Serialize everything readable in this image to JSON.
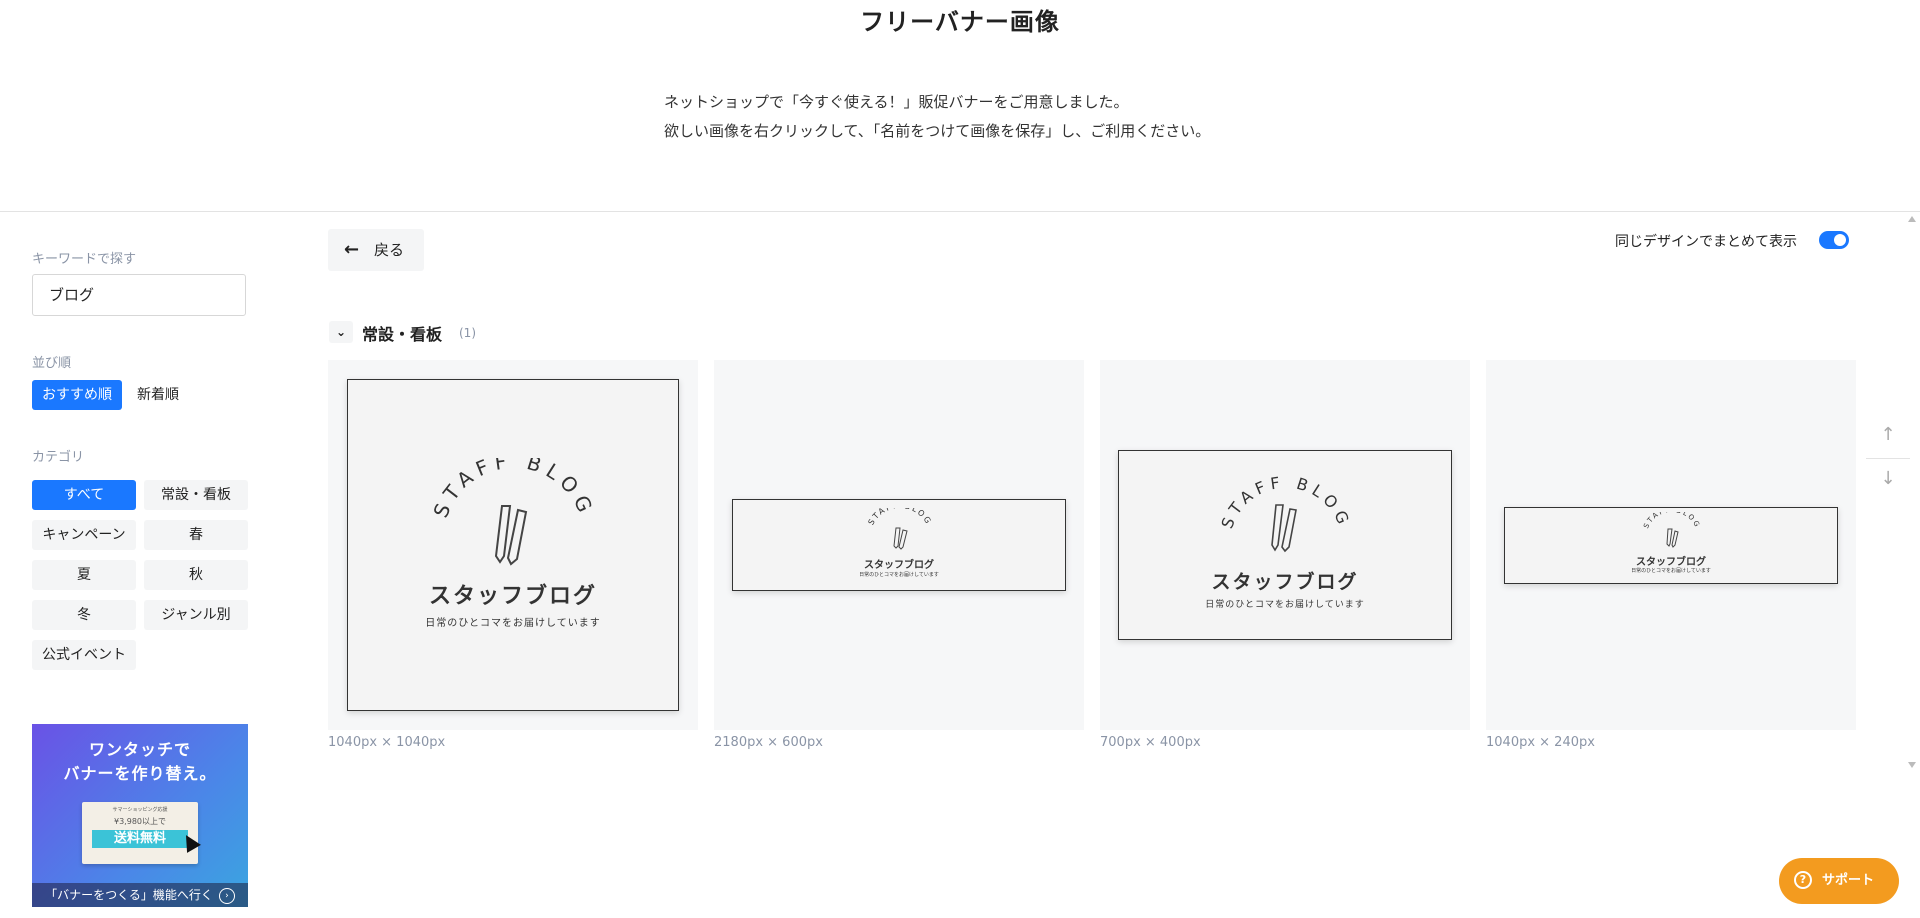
{
  "page": {
    "title": "フリーバナー画像",
    "intro_lines": [
      "ネットショップで「今すぐ使える！」販促バナーをご用意しました。",
      "欲しい画像を右クリックして、「名前をつけて画像を保存」し、ご利用ください。"
    ]
  },
  "sidebar": {
    "keyword_label": "キーワードで探す",
    "keyword_value": "ブログ",
    "sort_label": "並び順",
    "sort_options": [
      {
        "label": "おすすめ順",
        "active": true
      },
      {
        "label": "新着順",
        "active": false
      }
    ],
    "category_label": "カテゴリ",
    "categories": [
      {
        "label": "すべて",
        "active": true
      },
      {
        "label": "常設・看板",
        "active": false
      },
      {
        "label": "キャンペーン",
        "active": false
      },
      {
        "label": "春",
        "active": false
      },
      {
        "label": "夏",
        "active": false
      },
      {
        "label": "秋",
        "active": false
      },
      {
        "label": "冬",
        "active": false
      },
      {
        "label": "ジャンル別",
        "active": false
      },
      {
        "label": "公式イベント",
        "active": false
      }
    ],
    "promo": {
      "title": "ワンタッチで\nバナーを作り替え。",
      "card_sub": "サマーショッピング応援",
      "card_price": "¥3,980以上で",
      "card_free": "送料無料",
      "footer": "「バナーをつくる」機能へ行く"
    }
  },
  "toolbar": {
    "back_label": "戻る",
    "back_icon": "arrow-left-icon",
    "toggle_label": "同じデザインでまとめて表示",
    "toggle_on": true
  },
  "section": {
    "title": "常設・看板",
    "count": "(1)"
  },
  "banner_text": {
    "staff_blog": "STAFF BLOG",
    "jp_title": "スタッフブログ",
    "jp_sub": "日常のひとコマをお届けしています"
  },
  "cards": [
    {
      "size_label": "1040px × 1040px"
    },
    {
      "size_label": "2180px × 600px"
    },
    {
      "size_label": "700px × 400px"
    },
    {
      "size_label": "1040px × 240px"
    }
  ],
  "support": {
    "label": "サポート",
    "icon": "question-icon"
  },
  "colors": {
    "accent": "#1a78ff",
    "support": "#f39b1f",
    "muted": "#8a94a6"
  }
}
